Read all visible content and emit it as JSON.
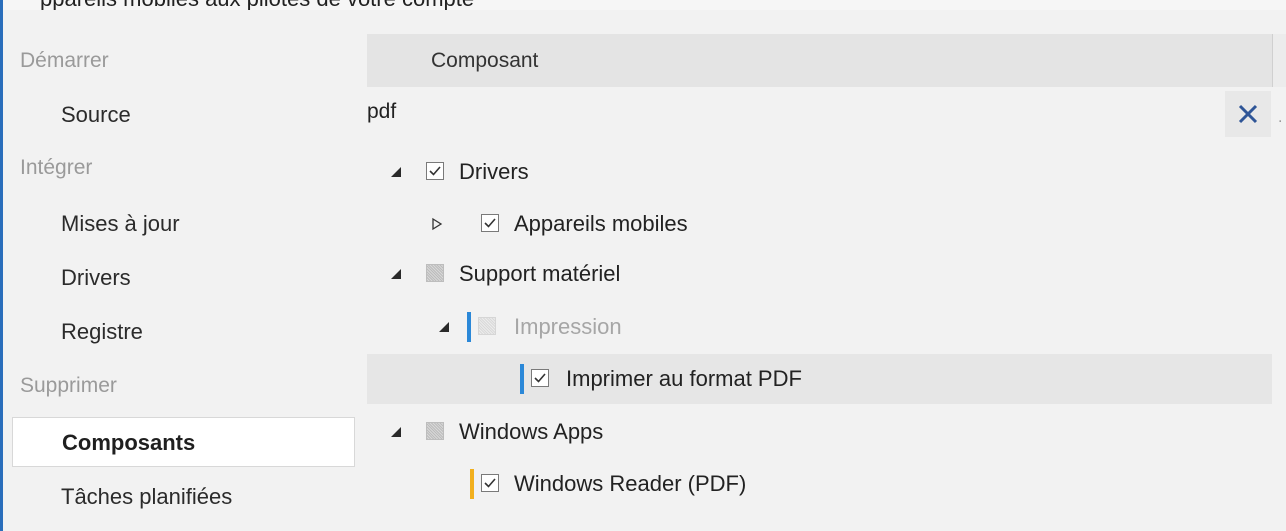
{
  "window": {
    "title_fragment": "ppareils mobiles aux pilotes de votre compte"
  },
  "sidebar": {
    "sections": [
      {
        "label": "Démarrer",
        "items": [
          "Source"
        ]
      },
      {
        "label": "Intégrer",
        "items": [
          "Mises à jour",
          "Drivers",
          "Registre"
        ]
      },
      {
        "label": "Supprimer",
        "items": [
          "Composants",
          "Tâches planifiées"
        ]
      }
    ],
    "active_item": "Composants"
  },
  "grid": {
    "column_header": "Composant",
    "filter_value": "pdf",
    "clear_icon": "close-icon"
  },
  "tree": [
    {
      "label": "Drivers",
      "level": 0,
      "expander": "expanded",
      "checkbox": "checked",
      "accent": null
    },
    {
      "label": "Appareils mobiles",
      "level": 1,
      "expander": "collapsed",
      "checkbox": "checked",
      "accent": null
    },
    {
      "label": "Support matériel",
      "level": 0,
      "expander": "expanded",
      "checkbox": "indeterminate",
      "accent": null
    },
    {
      "label": "Impression",
      "level": 1,
      "expander": "expanded",
      "checkbox": "disabled",
      "accent": "#2b88d8",
      "muted": true
    },
    {
      "label": "Imprimer au format PDF",
      "level": 2,
      "expander": null,
      "checkbox": "checked",
      "accent": "#2b88d8",
      "selected": true
    },
    {
      "label": "Windows Apps",
      "level": 0,
      "expander": "expanded",
      "checkbox": "indeterminate",
      "accent": null
    },
    {
      "label": "Windows Reader (PDF)",
      "level": 1,
      "expander": null,
      "checkbox": "checked",
      "accent": "#f2b01e"
    }
  ],
  "colors": {
    "accent_blue": "#2b88d8",
    "accent_yellow": "#f2b01e",
    "window_border": "#2a6ebb"
  }
}
